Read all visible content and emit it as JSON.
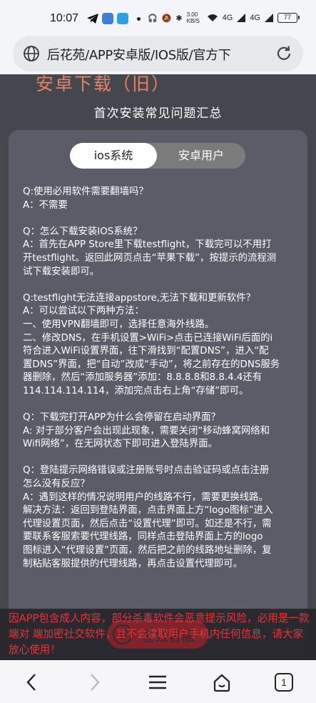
{
  "status_bar": {
    "time": "10:07",
    "net_speed": "3.00 KB/S",
    "signal_1": "4G",
    "signal_2": "4G",
    "battery": "77"
  },
  "address_bar": {
    "url_text": "后花苑/APP安卓版/IOS版/官方下"
  },
  "page": {
    "banner_title": "安卓下载（旧）",
    "section_heading": "首次安装常见问题汇总",
    "tabs": [
      {
        "label": "ios系统",
        "active": true
      },
      {
        "label": "安卓用户",
        "active": false
      }
    ],
    "faq": [
      {
        "lines": [
          "Q:使用必用软件需要翻墙吗？",
          "A：不需要"
        ]
      },
      {
        "lines": [
          "Q：怎么下载安装IOS系统？",
          "A：首先在APP Store里下载testflight，下载完可以不用打",
          "开testflight。返回此网页点击“苹果下载”，按提示的流程测",
          "试下载安装即可。"
        ]
      },
      {
        "lines": [
          "Q:testflight无法连接appstore,无法下载和更新软件？",
          "A：可以尝试以下两种方法：",
          "一、使用VPN翻墙即可，选择任意海外线路。",
          "二、修改DNS，在手机设置>WiFi>点击已连接WiFi后面的i",
          "符合进入WiFi设置界面，往下滑找到“配置DNS”，进入“配",
          "置DNS”界面，把“自动”改成“手动”，将之前存在的DNS服务",
          "器删除，然后“添加服务器”添加：8.8.8.8和8.8.4.4还有",
          "114.114.114.114，添加完点击右上角“存储”即可。"
        ]
      },
      {
        "lines": [
          "Q：下载完打开APP为什么会停留在启动界面？",
          "A: 对于部分客户会出现此现象，需要关闭“移动蜂窝网络和",
          "Wifi网络”，在无网状态下即可进入登陆界面。"
        ]
      },
      {
        "lines": [
          "Q：登陆提示网络错误或注册账号时点击验证码或点击注册",
          "怎么没有反应？",
          "A：遇到这样的情况说明用户的线路不行，需要更换线路。",
          "解决方法：返回到登陆界面，点击界面上方“logo图标”进入",
          "代理设置页面，然后点击“设置代理”即可。如还是不行，需",
          "要联系客服索要代理线路，同样点击登陆界面上方的logo",
          "图标进入“代理设置”页面，然后把之前的线路地址删除，复",
          "制粘贴客服提供的代理线路，再点击设置代理即可。"
        ]
      }
    ]
  },
  "warning": {
    "text": "因APP包含成人内容，部分杀毒软件会恶意提示风险，必用是一款端对 端加密社交软件，且不会读取用户手机内任何信息，请大家放心使用！",
    "cs_button_label": "在线客服",
    "cs_icon_glyph": "@"
  },
  "bottom_nav": {
    "tab_count": "1"
  },
  "colors": {
    "page_bg": "#45474f",
    "card_bg": "#5a5c68",
    "banner_orange": "#e8825d",
    "warning_red": "#e3363c",
    "cs_red": "#c7202a"
  }
}
